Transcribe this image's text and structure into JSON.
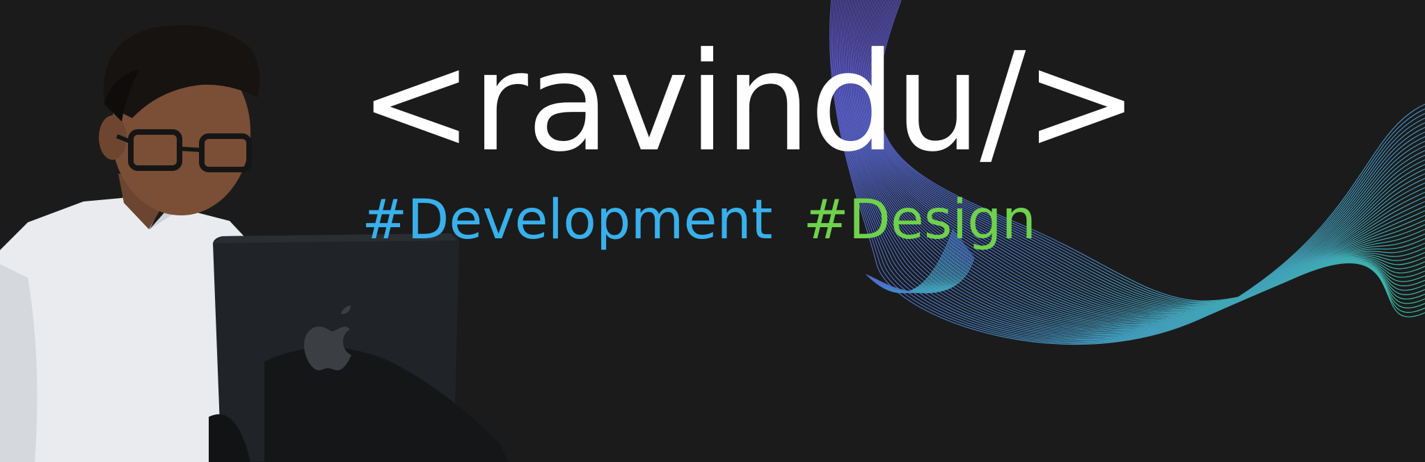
{
  "banner": {
    "title": "<ravindu/>",
    "tags": [
      {
        "label": "#Development",
        "color": "#38b0ec"
      },
      {
        "label": "#Design",
        "color": "#6fd14c"
      }
    ]
  },
  "colors": {
    "background": "#1b1b1b",
    "wave_start": "#6a5be0",
    "wave_end": "#3fd6b6"
  },
  "icons": [
    "apple-logo-icon"
  ]
}
